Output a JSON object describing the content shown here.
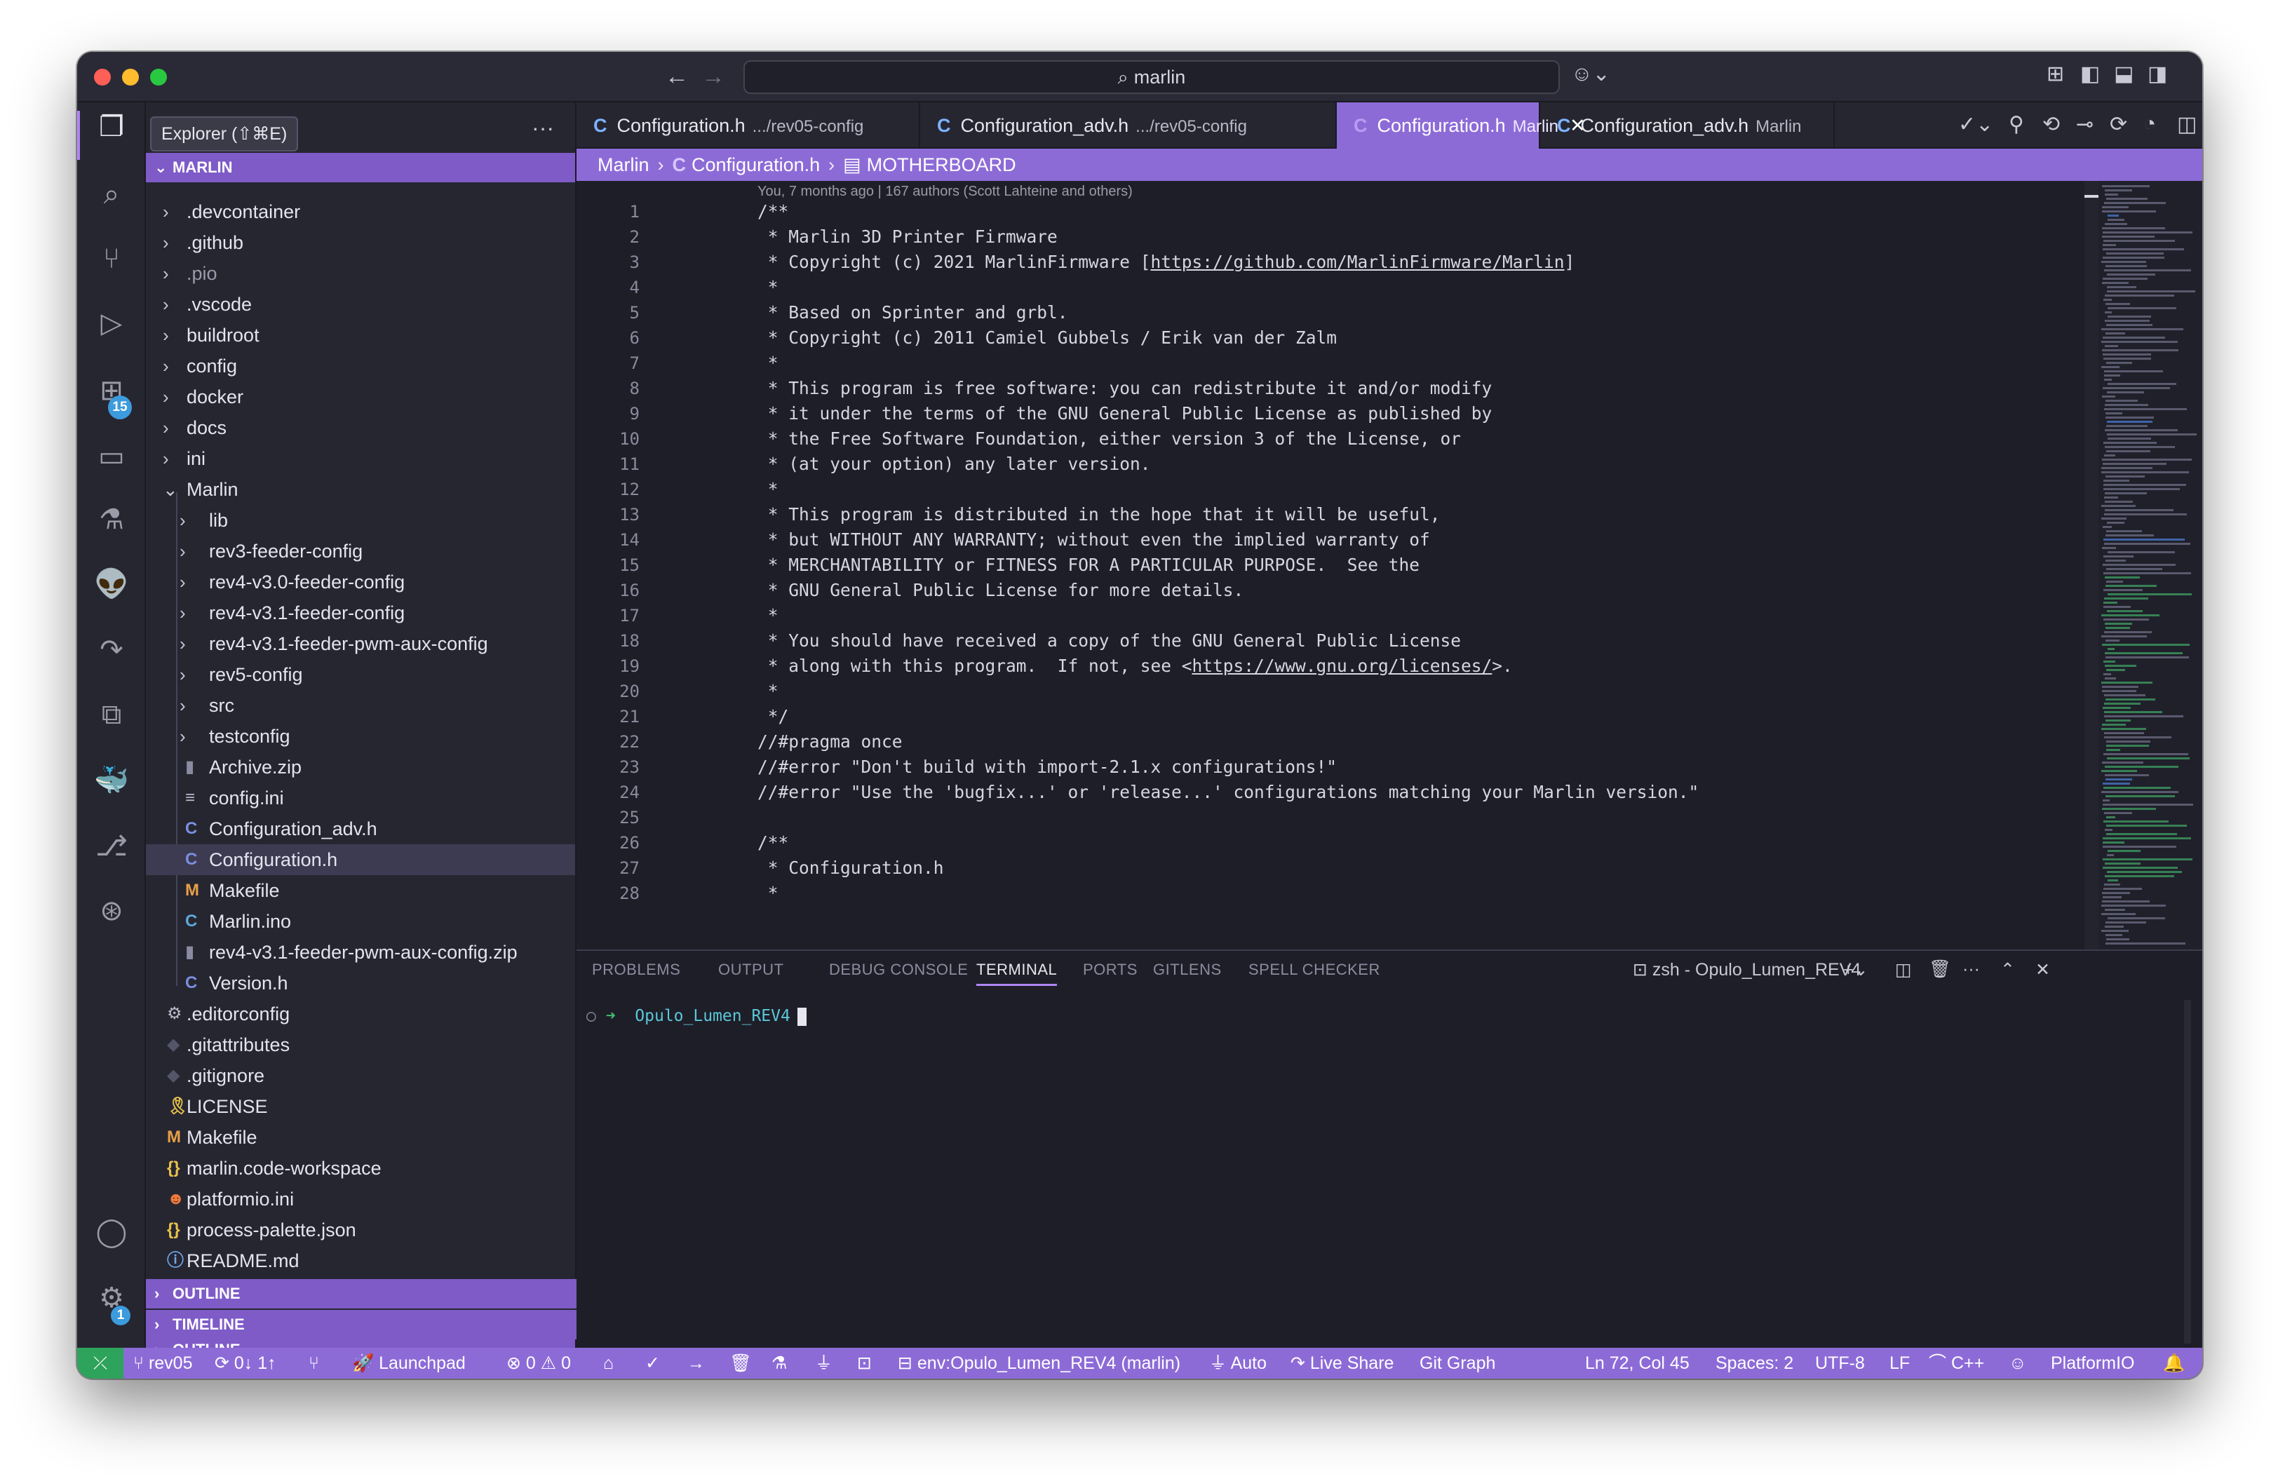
{
  "titlebar": {
    "back_icon": "arrow-left-icon",
    "forward_icon": "arrow-right-icon",
    "search_text": "marlin",
    "copilot_icon": "copilot-icon",
    "layout_icons": [
      "customize-layout-icon",
      "toggle-sidebar-icon",
      "toggle-panel-icon",
      "toggle-secondary-sidebar-icon"
    ]
  },
  "activitybar": {
    "items": [
      {
        "name": "explorer-icon",
        "glyph": "❐"
      },
      {
        "name": "search-icon",
        "glyph": "⌕"
      },
      {
        "name": "source-control-icon",
        "glyph": "⑂"
      },
      {
        "name": "run-debug-icon",
        "glyph": "▷"
      },
      {
        "name": "extensions-icon",
        "glyph": "⊞",
        "badge": "15"
      },
      {
        "name": "remote-explorer-icon",
        "glyph": "▭"
      },
      {
        "name": "testing-icon",
        "glyph": "⚗"
      },
      {
        "name": "platformio-icon",
        "glyph": "👽"
      },
      {
        "name": "live-share-icon",
        "glyph": "↷"
      },
      {
        "name": "project-manager-icon",
        "glyph": "⧉"
      },
      {
        "name": "docker-icon",
        "glyph": "🐳"
      },
      {
        "name": "gitlens-icon",
        "glyph": "⎇"
      },
      {
        "name": "git-graph-icon",
        "glyph": "⊛"
      }
    ],
    "accounts_icon": "account-icon",
    "settings_icon": "gear-icon",
    "settings_badge": "1"
  },
  "explorer": {
    "tooltip": "Explorer (⇧⌘E)",
    "root": "MARLIN",
    "items": [
      {
        "label": ".devcontainer",
        "type": "folder",
        "depth": 0
      },
      {
        "label": ".github",
        "type": "folder",
        "depth": 0
      },
      {
        "label": ".pio",
        "type": "folder",
        "depth": 0,
        "dim": true
      },
      {
        "label": ".vscode",
        "type": "folder",
        "depth": 0
      },
      {
        "label": "buildroot",
        "type": "folder",
        "depth": 0
      },
      {
        "label": "config",
        "type": "folder",
        "depth": 0
      },
      {
        "label": "docker",
        "type": "folder",
        "depth": 0
      },
      {
        "label": "docs",
        "type": "folder",
        "depth": 0
      },
      {
        "label": "ini",
        "type": "folder",
        "depth": 0
      },
      {
        "label": "Marlin",
        "type": "folder-open",
        "depth": 0
      },
      {
        "label": "lib",
        "type": "folder",
        "depth": 1
      },
      {
        "label": "rev3-feeder-config",
        "type": "folder",
        "depth": 1
      },
      {
        "label": "rev4-v3.0-feeder-config",
        "type": "folder",
        "depth": 1
      },
      {
        "label": "rev4-v3.1-feeder-config",
        "type": "folder",
        "depth": 1
      },
      {
        "label": "rev4-v3.1-feeder-pwm-aux-config",
        "type": "folder",
        "depth": 1
      },
      {
        "label": "rev5-config",
        "type": "folder",
        "depth": 1
      },
      {
        "label": "src",
        "type": "folder",
        "depth": 1
      },
      {
        "label": "testconfig",
        "type": "folder",
        "depth": 1
      },
      {
        "label": "Archive.zip",
        "type": "zip",
        "depth": 1
      },
      {
        "label": "config.ini",
        "type": "ini",
        "depth": 1
      },
      {
        "label": "Configuration_adv.h",
        "type": "c",
        "depth": 1
      },
      {
        "label": "Configuration.h",
        "type": "c",
        "depth": 1,
        "selected": true
      },
      {
        "label": "Makefile",
        "type": "make",
        "depth": 1
      },
      {
        "label": "Marlin.ino",
        "type": "ino",
        "depth": 1
      },
      {
        "label": "rev4-v3.1-feeder-pwm-aux-config.zip",
        "type": "zip",
        "depth": 1
      },
      {
        "label": "Version.h",
        "type": "c",
        "depth": 1
      },
      {
        "label": ".editorconfig",
        "type": "editorconfig",
        "depth": 0
      },
      {
        "label": ".gitattributes",
        "type": "git",
        "depth": 0
      },
      {
        "label": ".gitignore",
        "type": "git",
        "depth": 0
      },
      {
        "label": "LICENSE",
        "type": "license",
        "depth": 0
      },
      {
        "label": "Makefile",
        "type": "make",
        "depth": 0
      },
      {
        "label": "marlin.code-workspace",
        "type": "json",
        "depth": 0
      },
      {
        "label": "platformio.ini",
        "type": "pio",
        "depth": 0
      },
      {
        "label": "process-palette.json",
        "type": "json",
        "depth": 0
      },
      {
        "label": "README.md",
        "type": "info",
        "depth": 0
      }
    ],
    "outline": "OUTLINE",
    "timeline": "TIMELINE"
  },
  "tabs": [
    {
      "name": "Configuration.h",
      "desc": ".../rev05-config",
      "active": false
    },
    {
      "name": "Configuration_adv.h",
      "desc": ".../rev05-config",
      "active": false
    },
    {
      "name": "Configuration.h",
      "desc": "Marlin",
      "active": true
    },
    {
      "name": "Configuration_adv.h",
      "desc": "Marlin",
      "active": false
    }
  ],
  "tab_icon_letter": "C",
  "breadcrumb": {
    "folder": "Marlin",
    "file": "Configuration.h",
    "symbol": "MOTHERBOARD"
  },
  "blame": "You, 7 months ago | 167 authors (Scott Lahteine and others)",
  "code_lines": [
    "/**",
    " * Marlin 3D Printer Firmware",
    " * Copyright (c) 2021 MarlinFirmware [https://github.com/MarlinFirmware/Marlin]",
    " *",
    " * Based on Sprinter and grbl.",
    " * Copyright (c) 2011 Camiel Gubbels / Erik van der Zalm",
    " *",
    " * This program is free software: you can redistribute it and/or modify",
    " * it under the terms of the GNU General Public License as published by",
    " * the Free Software Foundation, either version 3 of the License, or",
    " * (at your option) any later version.",
    " *",
    " * This program is distributed in the hope that it will be useful,",
    " * but WITHOUT ANY WARRANTY; without even the implied warranty of",
    " * MERCHANTABILITY or FITNESS FOR A PARTICULAR PURPOSE.  See the",
    " * GNU General Public License for more details.",
    " *",
    " * You should have received a copy of the GNU General Public License",
    " * along with this program.  If not, see <https://www.gnu.org/licenses/>.",
    " *",
    " */",
    "//#pragma once",
    "//#error \"Don't build with import-2.1.x configurations!\"",
    "//#error \"Use the 'bugfix...' or 'release...' configurations matching your Marlin version.\"",
    "",
    "/**",
    " * Configuration.h",
    " *"
  ],
  "panel": {
    "tabs": [
      "PROBLEMS",
      "OUTPUT",
      "DEBUG CONSOLE",
      "TERMINAL",
      "PORTS",
      "GITLENS",
      "SPELL CHECKER"
    ],
    "active_tab": "TERMINAL",
    "terminal_name": "zsh - Opulo_Lumen_REV4",
    "prompt_dir": "Opulo_Lumen_REV4"
  },
  "statusbar": {
    "branch": "rev05",
    "sync": "0↓ 1↑",
    "launchpad": "Launchpad",
    "errors": "0",
    "warnings": "0",
    "env": "env:Opulo_Lumen_REV4 (marlin)",
    "auto": "Auto",
    "live_share": "Live Share",
    "git_graph": "Git Graph",
    "position": "Ln 72, Col 45",
    "spaces": "Spaces: 2",
    "encoding": "UTF-8",
    "eol": "LF",
    "language": "C++",
    "platformio": "PlatformIO"
  },
  "colors": {
    "accent": "#8d6bd7",
    "status_remote": "#2ea35b",
    "background": "#1e1e28"
  }
}
